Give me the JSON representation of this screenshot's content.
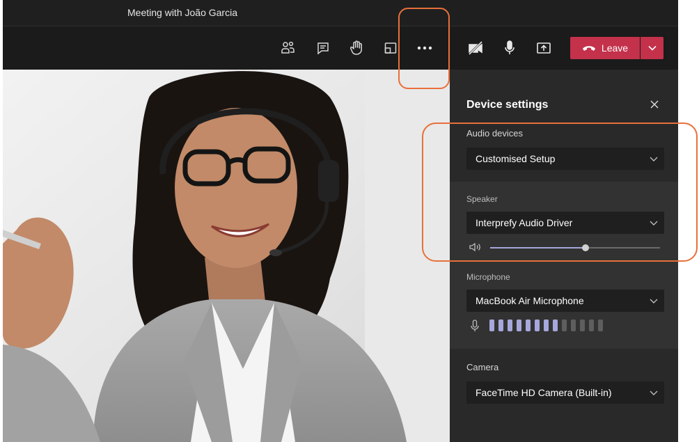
{
  "window": {
    "title": "Meeting with João Garcia"
  },
  "toolbar": {
    "icons": [
      "participants-icon",
      "chat-icon",
      "raise-hand-icon",
      "share-tray-icon",
      "more-actions-icon",
      "camera-off-icon",
      "microphone-icon",
      "share-screen-icon"
    ],
    "leave_label": "Leave"
  },
  "panel": {
    "title": "Device settings",
    "audio_devices": {
      "label": "Audio devices",
      "value": "Customised Setup"
    },
    "speaker": {
      "label": "Speaker",
      "value": "Interprefy Audio Driver",
      "volume": 0.56
    },
    "microphone": {
      "label": "Microphone",
      "value": "MacBook Air Microphone",
      "level_bars_total": 13,
      "level_bars_active": 8
    },
    "camera": {
      "label": "Camera",
      "value": "FaceTime HD Camera (Built-in)"
    }
  },
  "colors": {
    "leave_red": "#c4314b",
    "accent": "#a6a7dc",
    "highlight_orange": "#e8703a"
  }
}
